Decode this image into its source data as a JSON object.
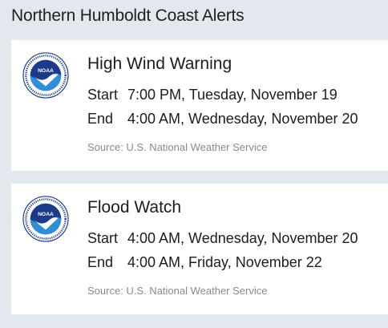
{
  "page": {
    "title": "Northern Humboldt Coast Alerts"
  },
  "logo": {
    "text": "NOAA",
    "ring_text": "NATIONAL OCEANIC AND ATMOSPHERIC ADMINISTRATION · U.S. DEPARTMENT OF COMMERCE"
  },
  "colors": {
    "background": "#e3e8ef",
    "card": "#ffffff",
    "noaa_navy": "#1b3a8c",
    "noaa_blue": "#2f8fd6"
  },
  "alerts": [
    {
      "title": "High Wind Warning",
      "start_label": "Start",
      "start_value": "7:00 PM, Tuesday, November 19",
      "end_label": "End",
      "end_value": "4:00 AM, Wednesday, November 20",
      "source": "Source: U.S. National Weather Service",
      "icon": "noaa-logo-icon"
    },
    {
      "title": "Flood Watch",
      "start_label": "Start",
      "start_value": "4:00 AM, Wednesday, November 20",
      "end_label": "End",
      "end_value": "4:00 AM, Friday, November 22",
      "source": "Source: U.S. National Weather Service",
      "icon": "noaa-logo-icon"
    }
  ]
}
